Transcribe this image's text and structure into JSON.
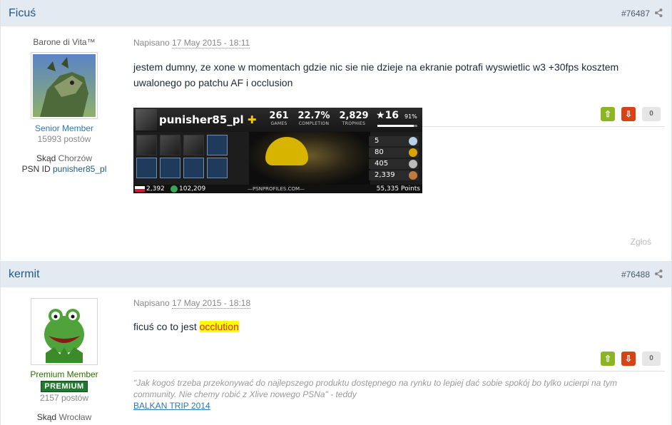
{
  "posts": [
    {
      "author": "Ficuś",
      "post_number": "#76487",
      "user_title": "Barone di Vita™",
      "group": "Senior Member",
      "posts_count": "15993 postów",
      "location_label": "Skąd",
      "location": "Chorzów",
      "psn_label": "PSN ID",
      "psn_id": "punisher85_pl",
      "posted_label": "Napisano",
      "date": "17 May 2015 - 18:11",
      "content_lines": [
        "jestem dumny, ze xone w momentach gdzie nic sie nie dzieje na ekranie potrafi wyswietlic w3 +30fps kosztem",
        "uwalonego po patchu AF i occlusion"
      ],
      "rep_count": "0",
      "report_label": "Zgłoś",
      "psn_card": {
        "name": "punisher85_pl",
        "plus": "✚",
        "games_value": "261",
        "games_label": "GAMES",
        "completion_value": "22.7%",
        "completion_label": "COMPLETION",
        "trophies_value": "2,829",
        "trophies_label": "TROPHIES",
        "level": "16",
        "level_pct": "91%",
        "level_progress": 0.91,
        "platinum": "5",
        "gold": "80",
        "silver": "405",
        "bronze": "2,339",
        "country_rank": "2,392",
        "world_rank": "102,209",
        "site": "—PSNPROFILES.COM—",
        "points": "55,335 Points"
      }
    },
    {
      "author": "kermit",
      "post_number": "#76488",
      "group": "Premium Member",
      "badge": "PREMIUM",
      "posts_count": "2157 postów",
      "location_label": "Skąd",
      "location": "Wrocław",
      "posted_label": "Napisano",
      "date": "17 May 2015 - 18:18",
      "content_prefix": "ficuś co to jest ",
      "content_highlight": "occlution",
      "rep_count": "0",
      "signature": "\"Jak kogoś trzeba przekonywać do najlepszego produktu dostępnego na rynku to lepiej dać sobie spokój bo tylko ucierpi na tym community. Nie chemy robić z Xlive nowego PSNa\" - teddy",
      "signature_link": "BALKAN TRIP 2014"
    }
  ],
  "colors": {
    "header_bg": "#e4eaf2",
    "link": "#225985",
    "rep_up": "#8bb522",
    "rep_down": "#d84315",
    "highlight": "#ffff00"
  }
}
